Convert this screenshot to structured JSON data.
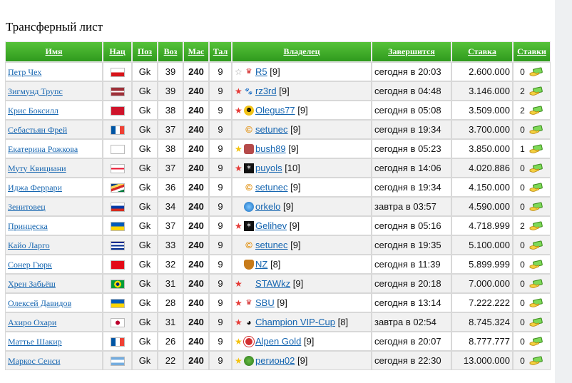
{
  "page": {
    "title": "Трансферный лист"
  },
  "table": {
    "headers": {
      "name": "Имя",
      "nat": "Нац",
      "pos": "Поз",
      "age": "Воз",
      "mas": "Мас",
      "tal": "Тал",
      "owner": "Владелец",
      "ends": "Завершится",
      "bid": "Ставка",
      "bids": "Ставки"
    },
    "rows": [
      {
        "name": "Петр Чех",
        "flag": "czech",
        "pos": "Gk",
        "age": "39",
        "mas": "240",
        "tal": "9",
        "star": "gray",
        "badge": "crown",
        "owner": "R5",
        "owner_level": "[9]",
        "ends": "сегодня в 20:03",
        "bid": "2.600.000",
        "count": "0"
      },
      {
        "name": "Зигмунд Трупс",
        "flag": "latvia",
        "pos": "Gk",
        "age": "39",
        "mas": "240",
        "tal": "9",
        "star": "red",
        "badge": "panther",
        "owner": "rz3rd",
        "owner_level": "[9]",
        "ends": "сегодня в 04:48",
        "bid": "3.146.000",
        "count": "2"
      },
      {
        "name": "Крис Боксилл",
        "flag": "bermuda",
        "pos": "Gk",
        "age": "38",
        "mas": "240",
        "tal": "9",
        "star": "red",
        "badge": "smiley",
        "owner": "Olegus77",
        "owner_level": "[9]",
        "ends": "сегодня в 05:08",
        "bid": "3.509.000",
        "count": "2"
      },
      {
        "name": "Себастьян Фрей",
        "flag": "france",
        "pos": "Gk",
        "age": "37",
        "mas": "240",
        "tal": "9",
        "star": "",
        "badge": "copyright",
        "owner": "setunec",
        "owner_level": "[9]",
        "ends": "сегодня в 19:34",
        "bid": "3.700.000",
        "count": "0"
      },
      {
        "name": "Екатерина Рожкова",
        "flag": "blank",
        "pos": "Gk",
        "age": "38",
        "mas": "240",
        "tal": "9",
        "star": "yellow",
        "badge": "gloves",
        "owner": "bush89",
        "owner_level": "[9]",
        "ends": "сегодня в 05:23",
        "bid": "3.850.000",
        "count": "1"
      },
      {
        "name": "Муту Квициани",
        "flag": "georgia",
        "pos": "Gk",
        "age": "37",
        "mas": "240",
        "tal": "9",
        "star": "red",
        "badge": "dark",
        "owner": "puyols",
        "owner_level": "[10]",
        "ends": "сегодня в 14:06",
        "bid": "4.020.886",
        "count": "0"
      },
      {
        "name": "Иджа Феррари",
        "flag": "seychelles",
        "pos": "Gk",
        "age": "36",
        "mas": "240",
        "tal": "9",
        "star": "",
        "badge": "copyright",
        "owner": "setunec",
        "owner_level": "[9]",
        "ends": "сегодня в 19:34",
        "bid": "4.150.000",
        "count": "0"
      },
      {
        "name": "Зенитовец",
        "flag": "russia",
        "pos": "Gk",
        "age": "34",
        "mas": "240",
        "tal": "9",
        "star": "",
        "badge": "globe",
        "owner": "orkelo",
        "owner_level": "[9]",
        "ends": "завтра в 03:57",
        "bid": "4.590.000",
        "count": "0"
      },
      {
        "name": "Принцеска",
        "flag": "ukraine",
        "pos": "Gk",
        "age": "37",
        "mas": "240",
        "tal": "9",
        "star": "red",
        "badge": "dark",
        "owner": "Gelihev",
        "owner_level": "[9]",
        "ends": "сегодня в 05:16",
        "bid": "4.718.999",
        "count": "2"
      },
      {
        "name": "Кайо Ларго",
        "flag": "cuba",
        "pos": "Gk",
        "age": "33",
        "mas": "240",
        "tal": "9",
        "star": "",
        "badge": "copyright",
        "owner": "setunec",
        "owner_level": "[9]",
        "ends": "сегодня в 19:35",
        "bid": "5.100.000",
        "count": "0"
      },
      {
        "name": "Сонер Гюрк",
        "flag": "turkey",
        "pos": "Gk",
        "age": "32",
        "mas": "240",
        "tal": "9",
        "star": "",
        "badge": "shield",
        "owner": "NZ",
        "owner_level": "[8]",
        "ends": "сегодня в 11:39",
        "bid": "5.899.999",
        "count": "0"
      },
      {
        "name": "Хрен Забьёш",
        "flag": "brazil",
        "pos": "Gk",
        "age": "31",
        "mas": "240",
        "tal": "9",
        "star": "red",
        "badge": "blank",
        "owner": "STAWkz",
        "owner_level": "[9]",
        "ends": "сегодня в 20:18",
        "bid": "7.000.000",
        "count": "0"
      },
      {
        "name": "Олексей Давидов",
        "flag": "ukraine",
        "pos": "Gk",
        "age": "28",
        "mas": "240",
        "tal": "9",
        "star": "red",
        "badge": "crown",
        "owner": "SBU",
        "owner_level": "[9]",
        "ends": "сегодня в 13:14",
        "bid": "7.222.222",
        "count": "0"
      },
      {
        "name": "Ахиро Охари",
        "flag": "japan",
        "pos": "Gk",
        "age": "31",
        "mas": "240",
        "tal": "9",
        "star": "red",
        "badge": "panda",
        "owner": "Champion VIP-Cup",
        "owner_level": "[8]",
        "ends": "завтра в 02:54",
        "bid": "8.745.324",
        "count": "0"
      },
      {
        "name": "Маттье Шакир",
        "flag": "france",
        "pos": "Gk",
        "age": "26",
        "mas": "240",
        "tal": "9",
        "star": "yellow",
        "badge": "spartak",
        "owner": "Alpen Gold",
        "owner_level": "[9]",
        "ends": "сегодня в 20:07",
        "bid": "8.777.777",
        "count": "0"
      },
      {
        "name": "Маркос Сенси",
        "flag": "argentina",
        "pos": "Gk",
        "age": "22",
        "mas": "240",
        "tal": "9",
        "star": "yellow",
        "badge": "green",
        "owner": "регион02",
        "owner_level": "[9]",
        "ends": "сегодня в 22:30",
        "bid": "13.000.000",
        "count": "0"
      }
    ]
  },
  "colors": {
    "header_green": "#3fae2a",
    "mas_green": "#2e8f1c",
    "link_blue": "#1565b0"
  },
  "icons": {
    "bid_action": "green-hand-money-icon"
  }
}
